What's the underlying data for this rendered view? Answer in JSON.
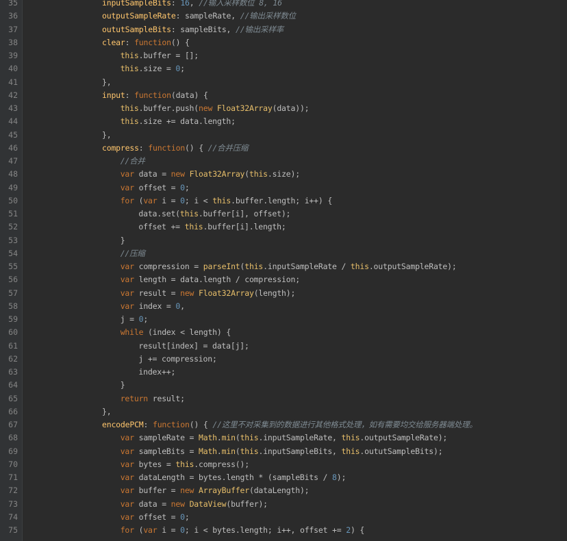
{
  "editor": {
    "colors": {
      "background": "#2b2b2b",
      "gutter": "#313335",
      "line_number": "#858585",
      "text": "#bfbfbf",
      "keyword": "#cc7832",
      "property": "#ffc66d",
      "number": "#6897bb",
      "comment": "#7f8b93"
    },
    "lines": [
      {
        "n": "35",
        "indent": 4,
        "tokens": [
          [
            "prop",
            "inputSampleBits"
          ],
          [
            "id",
            ": "
          ],
          [
            "num",
            "16"
          ],
          [
            "id",
            ", "
          ],
          [
            "com",
            "//输入采样数位 8, 16"
          ]
        ]
      },
      {
        "n": "36",
        "indent": 4,
        "tokens": [
          [
            "prop",
            "outputSampleRate"
          ],
          [
            "id",
            ": sampleRate, "
          ],
          [
            "com",
            "//输出采样数位"
          ]
        ]
      },
      {
        "n": "37",
        "indent": 4,
        "tokens": [
          [
            "prop",
            "oututSampleBits"
          ],
          [
            "id",
            ": sampleBits, "
          ],
          [
            "com",
            "//输出采样率"
          ]
        ]
      },
      {
        "n": "38",
        "indent": 4,
        "tokens": [
          [
            "prop",
            "clear"
          ],
          [
            "id",
            ": "
          ],
          [
            "kw",
            "function"
          ],
          [
            "id",
            "() {"
          ]
        ]
      },
      {
        "n": "39",
        "indent": 5,
        "tokens": [
          [
            "this",
            "this"
          ],
          [
            "id",
            ".buffer = [];"
          ]
        ]
      },
      {
        "n": "40",
        "indent": 5,
        "tokens": [
          [
            "this",
            "this"
          ],
          [
            "id",
            ".size = "
          ],
          [
            "num",
            "0"
          ],
          [
            "id",
            ";"
          ]
        ]
      },
      {
        "n": "41",
        "indent": 4,
        "tokens": [
          [
            "id",
            "},"
          ]
        ]
      },
      {
        "n": "42",
        "indent": 4,
        "tokens": [
          [
            "prop",
            "input"
          ],
          [
            "id",
            ": "
          ],
          [
            "kw",
            "function"
          ],
          [
            "id",
            "(data) {"
          ]
        ]
      },
      {
        "n": "43",
        "indent": 5,
        "tokens": [
          [
            "this",
            "this"
          ],
          [
            "id",
            ".buffer.push("
          ],
          [
            "kw",
            "new "
          ],
          [
            "cls",
            "Float32Array"
          ],
          [
            "id",
            "(data));"
          ]
        ]
      },
      {
        "n": "44",
        "indent": 5,
        "tokens": [
          [
            "this",
            "this"
          ],
          [
            "id",
            ".size += data.length;"
          ]
        ]
      },
      {
        "n": "45",
        "indent": 4,
        "tokens": [
          [
            "id",
            "},"
          ]
        ]
      },
      {
        "n": "46",
        "indent": 4,
        "tokens": [
          [
            "prop",
            "compress"
          ],
          [
            "id",
            ": "
          ],
          [
            "kw",
            "function"
          ],
          [
            "id",
            "() { "
          ],
          [
            "com",
            "//合并压缩"
          ]
        ]
      },
      {
        "n": "47",
        "indent": 5,
        "tokens": [
          [
            "com",
            "//合并"
          ]
        ]
      },
      {
        "n": "48",
        "indent": 5,
        "tokens": [
          [
            "kw",
            "var "
          ],
          [
            "id",
            "data = "
          ],
          [
            "kw",
            "new "
          ],
          [
            "cls",
            "Float32Array"
          ],
          [
            "id",
            "("
          ],
          [
            "this",
            "this"
          ],
          [
            "id",
            ".size);"
          ]
        ]
      },
      {
        "n": "49",
        "indent": 5,
        "tokens": [
          [
            "kw",
            "var "
          ],
          [
            "id",
            "offset = "
          ],
          [
            "num",
            "0"
          ],
          [
            "id",
            ";"
          ]
        ]
      },
      {
        "n": "50",
        "indent": 5,
        "tokens": [
          [
            "kw",
            "for "
          ],
          [
            "id",
            "("
          ],
          [
            "kw",
            "var "
          ],
          [
            "id",
            "i = "
          ],
          [
            "num",
            "0"
          ],
          [
            "id",
            "; i < "
          ],
          [
            "this",
            "this"
          ],
          [
            "id",
            ".buffer.length; i++) {"
          ]
        ]
      },
      {
        "n": "51",
        "indent": 6,
        "tokens": [
          [
            "id",
            "data.set("
          ],
          [
            "this",
            "this"
          ],
          [
            "id",
            ".buffer[i], offset);"
          ]
        ]
      },
      {
        "n": "52",
        "indent": 6,
        "tokens": [
          [
            "id",
            "offset += "
          ],
          [
            "this",
            "this"
          ],
          [
            "id",
            ".buffer[i].length;"
          ]
        ]
      },
      {
        "n": "53",
        "indent": 5,
        "tokens": [
          [
            "id",
            "}"
          ]
        ]
      },
      {
        "n": "54",
        "indent": 5,
        "tokens": [
          [
            "com",
            "//压缩"
          ]
        ]
      },
      {
        "n": "55",
        "indent": 5,
        "tokens": [
          [
            "kw",
            "var "
          ],
          [
            "id",
            "compression = "
          ],
          [
            "cls",
            "parseInt"
          ],
          [
            "id",
            "("
          ],
          [
            "this",
            "this"
          ],
          [
            "id",
            ".inputSampleRate / "
          ],
          [
            "this",
            "this"
          ],
          [
            "id",
            ".outputSampleRate);"
          ]
        ]
      },
      {
        "n": "56",
        "indent": 5,
        "tokens": [
          [
            "kw",
            "var "
          ],
          [
            "id",
            "length = data.length / compression;"
          ]
        ]
      },
      {
        "n": "57",
        "indent": 5,
        "tokens": [
          [
            "kw",
            "var "
          ],
          [
            "id",
            "result = "
          ],
          [
            "kw",
            "new "
          ],
          [
            "cls",
            "Float32Array"
          ],
          [
            "id",
            "(length);"
          ]
        ]
      },
      {
        "n": "58",
        "indent": 5,
        "tokens": [
          [
            "kw",
            "var "
          ],
          [
            "id",
            "index = "
          ],
          [
            "num",
            "0"
          ],
          [
            "id",
            ","
          ]
        ]
      },
      {
        "n": "59",
        "indent": 5,
        "tokens": [
          [
            "id",
            "j = "
          ],
          [
            "num",
            "0"
          ],
          [
            "id",
            ";"
          ]
        ]
      },
      {
        "n": "60",
        "indent": 5,
        "tokens": [
          [
            "kw",
            "while "
          ],
          [
            "id",
            "(index < length) {"
          ]
        ]
      },
      {
        "n": "61",
        "indent": 6,
        "tokens": [
          [
            "id",
            "result[index] = data[j];"
          ]
        ]
      },
      {
        "n": "62",
        "indent": 6,
        "tokens": [
          [
            "id",
            "j += compression;"
          ]
        ]
      },
      {
        "n": "63",
        "indent": 6,
        "tokens": [
          [
            "id",
            "index++;"
          ]
        ]
      },
      {
        "n": "64",
        "indent": 5,
        "tokens": [
          [
            "id",
            "}"
          ]
        ]
      },
      {
        "n": "65",
        "indent": 5,
        "tokens": [
          [
            "kw",
            "return "
          ],
          [
            "id",
            "result;"
          ]
        ]
      },
      {
        "n": "66",
        "indent": 4,
        "tokens": [
          [
            "id",
            "},"
          ]
        ]
      },
      {
        "n": "67",
        "indent": 4,
        "tokens": [
          [
            "prop",
            "encodePCM"
          ],
          [
            "id",
            ": "
          ],
          [
            "kw",
            "function"
          ],
          [
            "id",
            "() { "
          ],
          [
            "com",
            "//这里不对采集到的数据进行其他格式处理，如有需要均交给服务器端处理。"
          ]
        ]
      },
      {
        "n": "68",
        "indent": 5,
        "tokens": [
          [
            "kw",
            "var "
          ],
          [
            "id",
            "sampleRate = "
          ],
          [
            "cls",
            "Math"
          ],
          [
            "id",
            "."
          ],
          [
            "cls",
            "min"
          ],
          [
            "id",
            "("
          ],
          [
            "this",
            "this"
          ],
          [
            "id",
            ".inputSampleRate, "
          ],
          [
            "this",
            "this"
          ],
          [
            "id",
            ".outputSampleRate);"
          ]
        ]
      },
      {
        "n": "69",
        "indent": 5,
        "tokens": [
          [
            "kw",
            "var "
          ],
          [
            "id",
            "sampleBits = "
          ],
          [
            "cls",
            "Math"
          ],
          [
            "id",
            "."
          ],
          [
            "cls",
            "min"
          ],
          [
            "id",
            "("
          ],
          [
            "this",
            "this"
          ],
          [
            "id",
            ".inputSampleBits, "
          ],
          [
            "this",
            "this"
          ],
          [
            "id",
            ".oututSampleBits);"
          ]
        ]
      },
      {
        "n": "70",
        "indent": 5,
        "tokens": [
          [
            "kw",
            "var "
          ],
          [
            "id",
            "bytes = "
          ],
          [
            "this",
            "this"
          ],
          [
            "id",
            ".compress();"
          ]
        ]
      },
      {
        "n": "71",
        "indent": 5,
        "tokens": [
          [
            "kw",
            "var "
          ],
          [
            "id",
            "dataLength = bytes.length * (sampleBits / "
          ],
          [
            "num",
            "8"
          ],
          [
            "id",
            ");"
          ]
        ]
      },
      {
        "n": "72",
        "indent": 5,
        "tokens": [
          [
            "kw",
            "var "
          ],
          [
            "id",
            "buffer = "
          ],
          [
            "kw",
            "new "
          ],
          [
            "cls",
            "ArrayBuffer"
          ],
          [
            "id",
            "(dataLength);"
          ]
        ]
      },
      {
        "n": "73",
        "indent": 5,
        "tokens": [
          [
            "kw",
            "var "
          ],
          [
            "id",
            "data = "
          ],
          [
            "kw",
            "new "
          ],
          [
            "cls",
            "DataView"
          ],
          [
            "id",
            "(buffer);"
          ]
        ]
      },
      {
        "n": "74",
        "indent": 5,
        "tokens": [
          [
            "kw",
            "var "
          ],
          [
            "id",
            "offset = "
          ],
          [
            "num",
            "0"
          ],
          [
            "id",
            ";"
          ]
        ]
      },
      {
        "n": "75",
        "indent": 5,
        "tokens": [
          [
            "kw",
            "for "
          ],
          [
            "id",
            "("
          ],
          [
            "kw",
            "var "
          ],
          [
            "id",
            "i = "
          ],
          [
            "num",
            "0"
          ],
          [
            "id",
            "; i < bytes.length; i++, offset += "
          ],
          [
            "num",
            "2"
          ],
          [
            "id",
            ") {"
          ]
        ]
      }
    ]
  }
}
